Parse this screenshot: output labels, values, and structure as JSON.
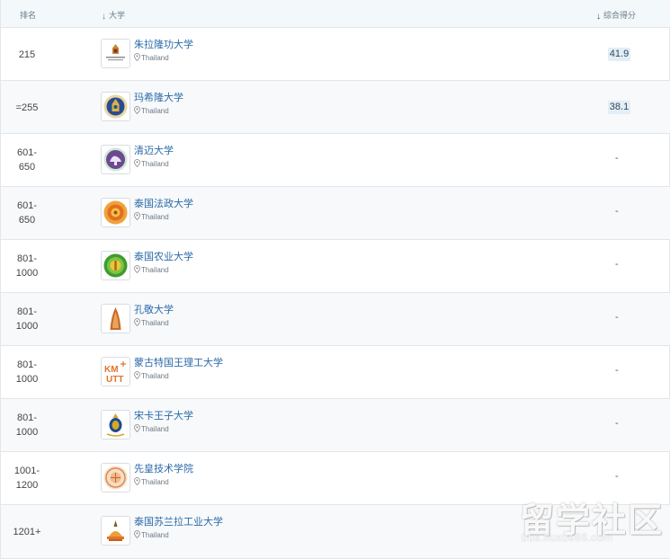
{
  "header": {
    "rank": "排名",
    "university": "大学",
    "score": "综合得分"
  },
  "rows": [
    {
      "rank_line1": "215",
      "rank_line2": "",
      "name": "朱拉隆功大学",
      "country": "Thailand",
      "score": "41.9"
    },
    {
      "rank_line1": "=255",
      "rank_line2": "",
      "name": "玛希隆大学",
      "country": "Thailand",
      "score": "38.1"
    },
    {
      "rank_line1": "601-",
      "rank_line2": "650",
      "name": "清迈大学",
      "country": "Thailand",
      "score": "-"
    },
    {
      "rank_line1": "601-",
      "rank_line2": "650",
      "name": "泰国法政大学",
      "country": "Thailand",
      "score": "-"
    },
    {
      "rank_line1": "801-",
      "rank_line2": "1000",
      "name": "泰国农业大学",
      "country": "Thailand",
      "score": "-"
    },
    {
      "rank_line1": "801-",
      "rank_line2": "1000",
      "name": "孔敬大学",
      "country": "Thailand",
      "score": "-"
    },
    {
      "rank_line1": "801-",
      "rank_line2": "1000",
      "name": "蒙古特国王理工大学",
      "country": "Thailand",
      "score": "-"
    },
    {
      "rank_line1": "801-",
      "rank_line2": "1000",
      "name": "宋卡王子大学",
      "country": "Thailand",
      "score": "-"
    },
    {
      "rank_line1": "1001-",
      "rank_line2": "1200",
      "name": "先皇技术学院",
      "country": "Thailand",
      "score": "-"
    },
    {
      "rank_line1": "1201+",
      "rank_line2": "",
      "name": "泰国苏兰拉工业大学",
      "country": "Thailand",
      "score": "-"
    }
  ],
  "logo_text": {
    "kmutt": "KMUTT"
  },
  "watermark": {
    "main": "留学社区",
    "url": "bbs.liuxue86.com"
  },
  "colors": {
    "link": "#2b6aa8",
    "header_bg": "#f3f8fb",
    "score_bg": "#e3eef5",
    "row_alt_bg": "#f7f9fb"
  },
  "icons": {
    "sort": "arrow-down-icon",
    "location": "map-pin-icon"
  }
}
